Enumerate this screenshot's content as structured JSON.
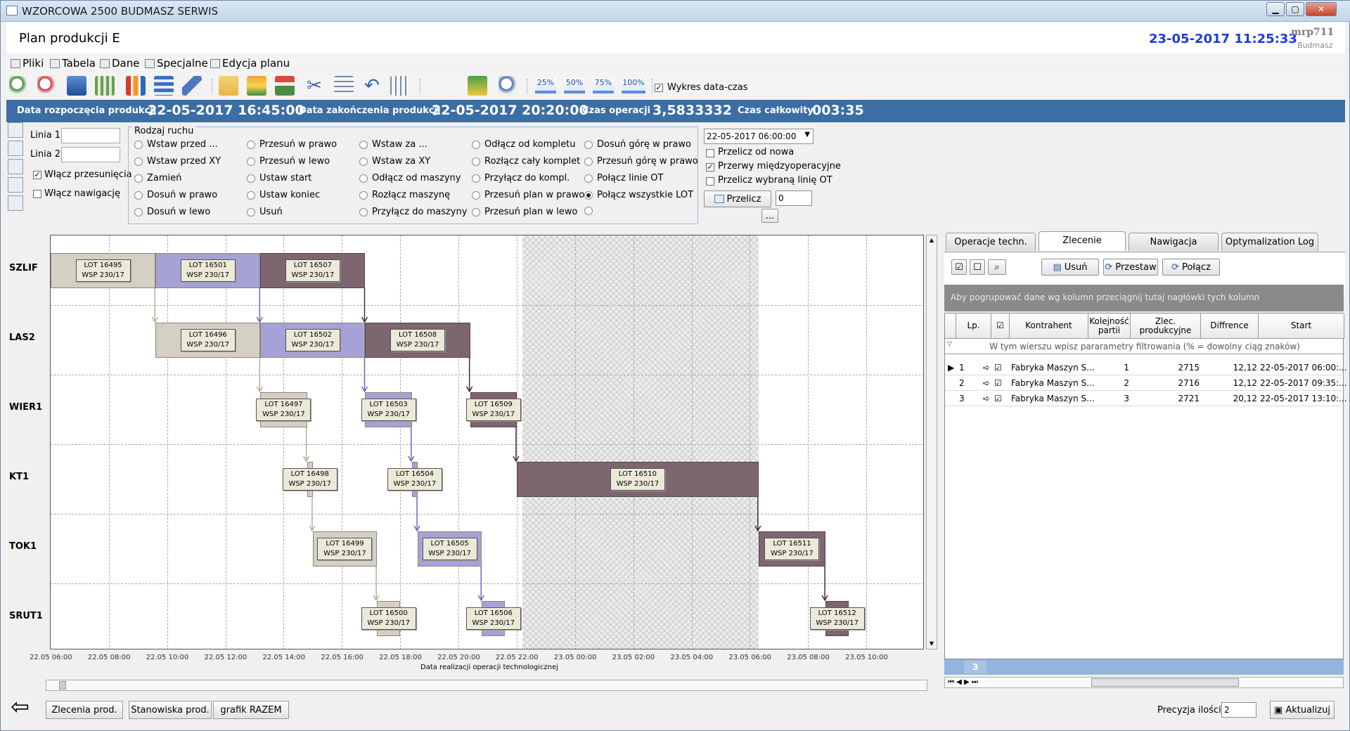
{
  "window": {
    "title": "WZORCOWA 2500 BUDMASZ SERWIS",
    "minimize": "▁",
    "maximize": "▢",
    "close": "✕"
  },
  "header": {
    "page_title": "Plan produkcji E",
    "datetime": "23-05-2017 11:25:33",
    "brand": "mrp711",
    "brand_sub": "Budmasz"
  },
  "menu": [
    "Pliki",
    "Tabela",
    "Dane",
    "Specjalne",
    "Edycja planu"
  ],
  "toolbar": {
    "zooms": [
      "25%",
      "50%",
      "75%",
      "100%"
    ],
    "chart_check_label": "Wykres data-czas"
  },
  "summary": {
    "start_label": "Data rozpoczęcia produkcji",
    "start_value": "22-05-2017 16:45:00",
    "end_label": "Data zakończenia produkcji",
    "end_value": "22-05-2017 20:20:00",
    "op_label": "Czas operacji",
    "op_value": "3,5833332",
    "total_label": "Czas całkowity",
    "total_value": "003:35"
  },
  "options": {
    "line1_label": "Linia 1",
    "line2_label": "Linia 2",
    "shift_label": "Włącz przesunięcia",
    "nav_label": "Włącz nawigację",
    "group_title": "Rodzaj ruchu",
    "moves": [
      [
        "Wstaw przed ...",
        "Wstaw przed XY",
        "Zamień",
        "Dosuń w prawo",
        "Dosuń w lewo"
      ],
      [
        "Przesuń w prawo",
        "Przesuń w lewo",
        "Ustaw start",
        "Ustaw koniec",
        "Usuń"
      ],
      [
        "Wstaw za ...",
        "Wstaw za XY",
        "Odłącz od maszyny",
        "Rozłącz maszynę",
        "Przyłącz do maszyny"
      ],
      [
        "Odłącz od kompletu",
        "Rozłącz cały komplet",
        "Przyłącz do kompl.",
        "Przesuń plan w prawo",
        "Przesuń plan w lewo"
      ],
      [
        "Dosuń górę w prawo",
        "Przesuń górę w prawo",
        "Połącz linie OT",
        "Połącz wszystkie LOT",
        ""
      ]
    ],
    "date_select": "22-05-2017 06:00:00",
    "recalc_new": "Przelicz od nowa",
    "breaks": "Przerwy międzyoperacyjne",
    "recalc_line": "Przelicz wybraną linię OT",
    "recalc_btn": "Przelicz",
    "recalc_num": "0",
    "more": "..."
  },
  "chart_data": {
    "type": "gantt",
    "rows": [
      "SZLIF",
      "LAS2",
      "WIER1",
      "KT1",
      "TOK1",
      "SRUT1"
    ],
    "x_ticks": [
      "22.05 06:00",
      "22.05 08:00",
      "22.05 10:00",
      "22.05 12:00",
      "22.05 14:00",
      "22.05 16:00",
      "22.05 18:00",
      "22.05 20:00",
      "22.05 22:00",
      "23.05 00:00",
      "23.05 02:00",
      "23.05 04:00",
      "23.05 06:00",
      "23.05 08:00",
      "23.05 10:00"
    ],
    "xlabel": "Data realizacji operacji technologicznej",
    "bars": [
      {
        "lot": "LOT 16495",
        "wsp": "WSP 230/17",
        "row": 0,
        "start": 0,
        "end": 3.6,
        "color": "#d5d0c4"
      },
      {
        "lot": "LOT 16501",
        "wsp": "WSP 230/17",
        "row": 0,
        "start": 3.6,
        "end": 7.2,
        "color": "#a6a2d6"
      },
      {
        "lot": "LOT 16507",
        "wsp": "WSP 230/17",
        "row": 0,
        "start": 7.2,
        "end": 10.8,
        "color": "#7d6670"
      },
      {
        "lot": "LOT 16496",
        "wsp": "WSP 230/17",
        "row": 1,
        "start": 3.6,
        "end": 7.2,
        "color": "#d5d0c4"
      },
      {
        "lot": "LOT 16502",
        "wsp": "WSP 230/17",
        "row": 1,
        "start": 7.2,
        "end": 10.8,
        "color": "#a6a2d6"
      },
      {
        "lot": "LOT 16508",
        "wsp": "WSP 230/17",
        "row": 1,
        "start": 10.8,
        "end": 14.4,
        "color": "#7d6670"
      },
      {
        "lot": "LOT 16497",
        "wsp": "WSP 230/17",
        "row": 2,
        "start": 7.2,
        "end": 8.8,
        "color": "#d5d0c4"
      },
      {
        "lot": "LOT 16503",
        "wsp": "WSP 230/17",
        "row": 2,
        "start": 10.8,
        "end": 12.4,
        "color": "#a6a2d6"
      },
      {
        "lot": "LOT 16509",
        "wsp": "WSP 230/17",
        "row": 2,
        "start": 14.4,
        "end": 16.0,
        "color": "#7d6670"
      },
      {
        "lot": "LOT 16498",
        "wsp": "WSP 230/17",
        "row": 3,
        "start": 8.8,
        "end": 9.0,
        "color": "#d5d0c4"
      },
      {
        "lot": "LOT 16504",
        "wsp": "WSP 230/17",
        "row": 3,
        "start": 12.4,
        "end": 12.6,
        "color": "#a6a2d6"
      },
      {
        "lot": "LOT 16510",
        "wsp": "WSP 230/17",
        "row": 3,
        "start": 16.0,
        "end": 24.3,
        "color": "#7d6670"
      },
      {
        "lot": "LOT 16499",
        "wsp": "WSP 230/17",
        "row": 4,
        "start": 9.0,
        "end": 11.2,
        "color": "#d5d0c4"
      },
      {
        "lot": "LOT 16505",
        "wsp": "WSP 230/17",
        "row": 4,
        "start": 12.6,
        "end": 14.8,
        "color": "#a6a2d6"
      },
      {
        "lot": "LOT 16511",
        "wsp": "WSP 230/17",
        "row": 4,
        "start": 24.3,
        "end": 26.6,
        "color": "#7d6670"
      },
      {
        "lot": "LOT 16500",
        "wsp": "WSP 230/17",
        "row": 5,
        "start": 11.2,
        "end": 12.0,
        "color": "#d5d0c4"
      },
      {
        "lot": "LOT 16506",
        "wsp": "WSP 230/17",
        "row": 5,
        "start": 14.8,
        "end": 15.6,
        "color": "#a6a2d6"
      },
      {
        "lot": "LOT 16512",
        "wsp": "WSP 230/17",
        "row": 5,
        "start": 26.6,
        "end": 27.4,
        "color": "#7d6670"
      }
    ],
    "break_start": 16.2,
    "break_end": 24.3
  },
  "right": {
    "tabs": [
      "Operacje techn.",
      "Zlecenie nadrzędne",
      "Nawigacja",
      "Optymalization Log"
    ],
    "btn_delete": "Usuń",
    "btn_move": "Przestaw",
    "btn_join": "Połącz",
    "group_hint": "Aby pogrupować dane wg kolumn przeciągnij tutaj nagłówki tych kolumn",
    "filter_hint": "W tym wierszu wpisz pararametry filtrowania (% = dowolny ciąg znaków)",
    "columns": [
      "Lp.",
      "",
      "Kontrahent",
      "Kolejność partii",
      "Zlec. produkcyjne",
      "Diffrence",
      "Start"
    ],
    "rows": [
      [
        "1",
        "Fabryka Maszyn S...",
        "1",
        "2715",
        "12,12",
        "22-05-2017 06:00:..."
      ],
      [
        "2",
        "Fabryka Maszyn S...",
        "2",
        "2716",
        "12,12",
        "22-05-2017 09:35:..."
      ],
      [
        "3",
        "Fabryka Maszyn S...",
        "3",
        "2721",
        "20,12",
        "22-05-2017 13:10:..."
      ]
    ],
    "count": "3"
  },
  "bottom": {
    "b1": "Zlecenia prod.",
    "b2": "Stanowiska prod.",
    "b3": "grafik RAZEM",
    "prec_label": "Precyzja ilości",
    "prec_value": "2",
    "update": "Aktualizuj"
  }
}
